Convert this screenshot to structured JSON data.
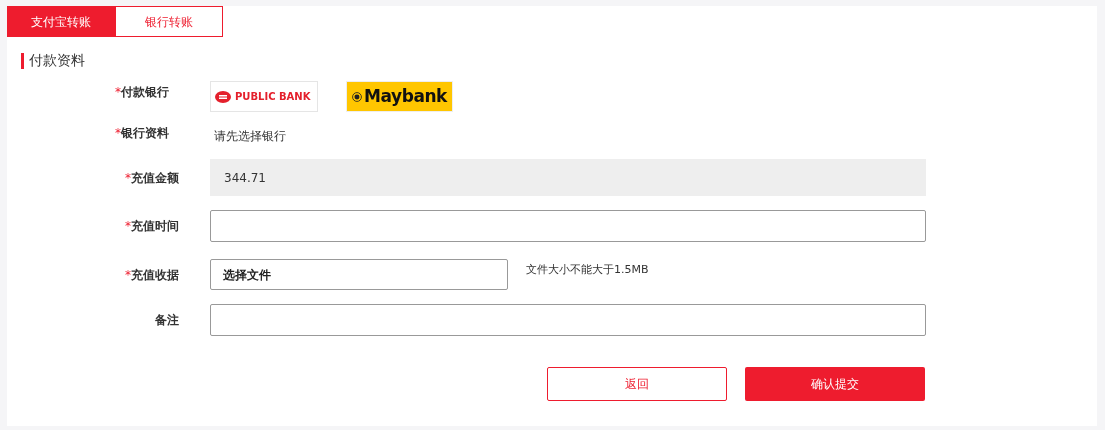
{
  "tabs": [
    {
      "label": "支付宝转账",
      "selected": true
    },
    {
      "label": "银行转账",
      "selected": false
    }
  ],
  "section_title": "付款资料",
  "fields": [
    {
      "kind": "banks",
      "label": "付款银行",
      "required_mark": "*",
      "banks": [
        {
          "logo_text": "PUBLIC BANK",
          "selected": false
        },
        {
          "logo_text": "Maybank",
          "selected": false
        }
      ]
    },
    {
      "kind": "text",
      "label": "银行资料",
      "required_mark": "*",
      "text": "请先选择银行"
    },
    {
      "kind": "input",
      "label": "充值金额",
      "required_mark": "*",
      "value": "344.71",
      "disabled": true
    },
    {
      "kind": "input",
      "label": "充值时间",
      "required_mark": "*",
      "disabled": false
    },
    {
      "kind": "file",
      "label": "充值收据",
      "required_mark": "*",
      "button": "选择文件",
      "hint": "文件大小不能大于1.5MB"
    },
    {
      "kind": "input",
      "label": "备注",
      "disabled": false
    }
  ],
  "buttons": [
    {
      "label": "返回",
      "primary": false
    },
    {
      "label": "确认提交",
      "primary": true
    }
  ]
}
